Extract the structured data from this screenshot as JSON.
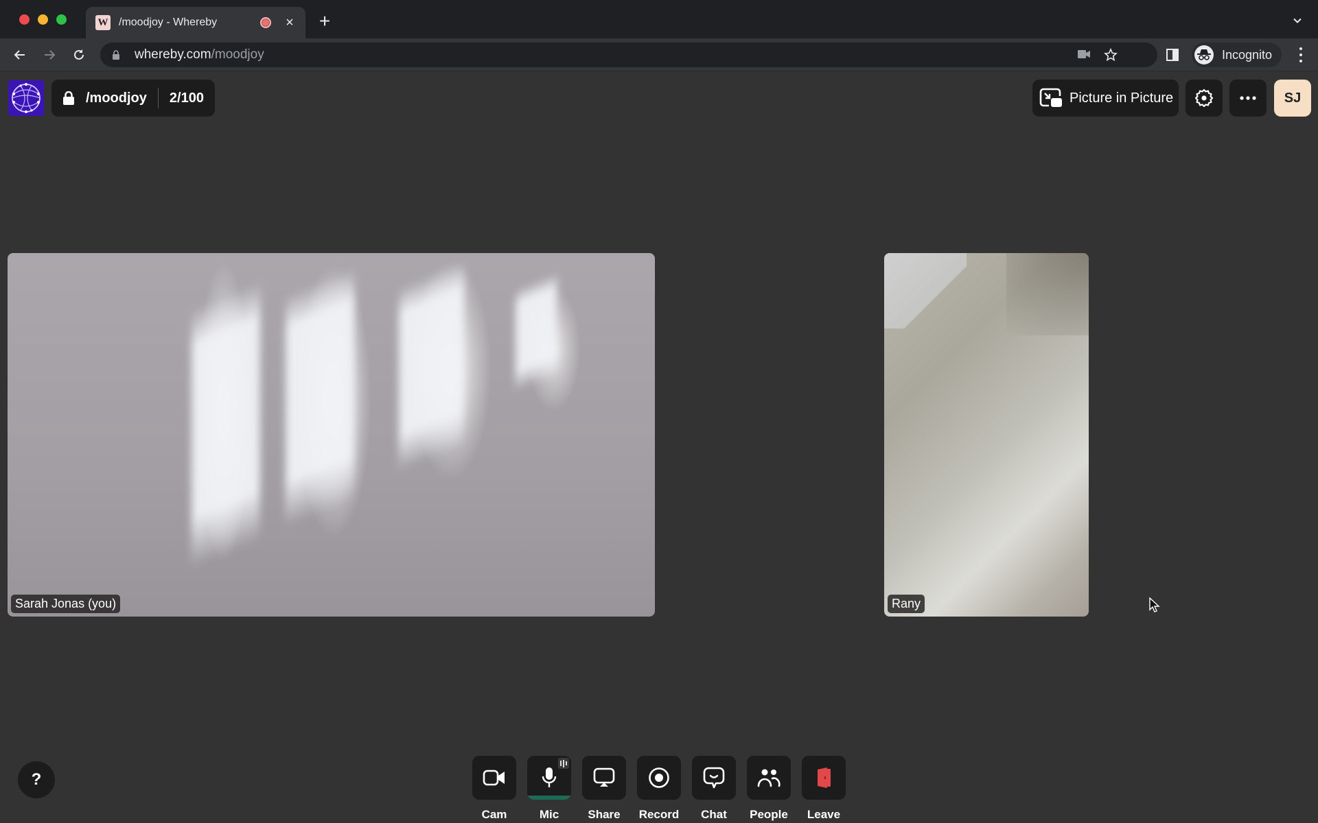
{
  "browser": {
    "tab": {
      "title": "/moodjoy - Whereby",
      "favicon_letter": "W",
      "recording_indicator": "recording-dot-icon",
      "close_label": "×"
    },
    "new_tab_label": "+",
    "address": {
      "domain": "whereby.com",
      "path": "/moodjoy"
    },
    "profile_label": "Incognito"
  },
  "room": {
    "name": "/moodjoy",
    "participant_count": "2/100"
  },
  "header": {
    "pip_label": "Picture in Picture",
    "avatar_initials": "SJ",
    "avatar_color": "#f6dfc5"
  },
  "participants": [
    {
      "name": "Sarah Jonas (you)"
    },
    {
      "name": "Rany"
    }
  ],
  "help_label": "?",
  "toolbar": {
    "items": [
      {
        "label": "Cam",
        "icon": "camera-icon"
      },
      {
        "label": "Mic",
        "icon": "microphone-icon",
        "active_speaking": true
      },
      {
        "label": "Share",
        "icon": "screen-share-icon"
      },
      {
        "label": "Record",
        "icon": "record-icon"
      },
      {
        "label": "Chat",
        "icon": "chat-icon"
      },
      {
        "label": "People",
        "icon": "people-icon"
      },
      {
        "label": "Leave",
        "icon": "leave-door-icon",
        "color": "#e0484a"
      }
    ]
  },
  "colors": {
    "app_background": "#333333",
    "control_background": "#1c1c1c",
    "mic_level": "#1e6b53",
    "logo_background": "#3b14b5"
  }
}
